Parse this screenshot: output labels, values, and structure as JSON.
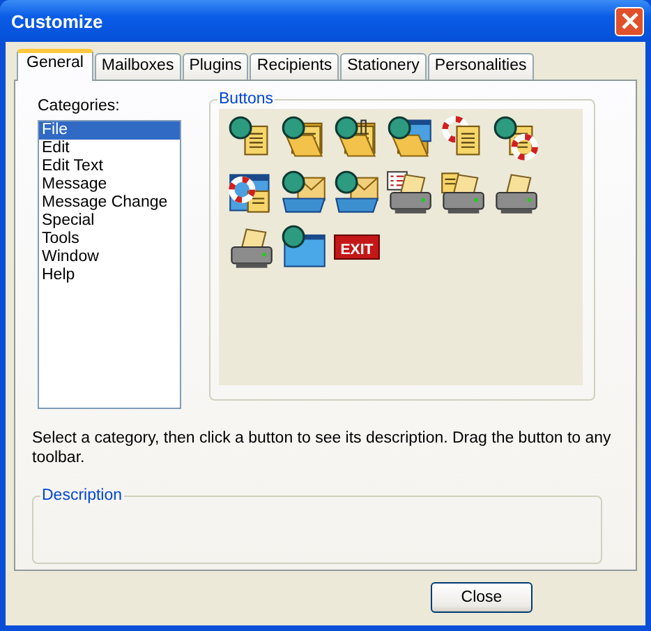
{
  "window": {
    "title": "Customize"
  },
  "tabs": [
    {
      "label": "General",
      "selected": true
    },
    {
      "label": "Mailboxes",
      "selected": false
    },
    {
      "label": "Plugins",
      "selected": false
    },
    {
      "label": "Recipients",
      "selected": false
    },
    {
      "label": "Stationery",
      "selected": false
    },
    {
      "label": "Personalities",
      "selected": false
    }
  ],
  "categories": {
    "label": "Categories:",
    "items": [
      {
        "label": "File",
        "selected": true
      },
      {
        "label": "Edit",
        "selected": false
      },
      {
        "label": "Edit Text",
        "selected": false
      },
      {
        "label": "Message",
        "selected": false
      },
      {
        "label": "Message Change",
        "selected": false
      },
      {
        "label": "Special",
        "selected": false
      },
      {
        "label": "Tools",
        "selected": false
      },
      {
        "label": "Window",
        "selected": false
      },
      {
        "label": "Help",
        "selected": false
      }
    ]
  },
  "buttons_group": {
    "title": "Buttons",
    "buttons": [
      {
        "kind": "globe-doc"
      },
      {
        "kind": "globe-folder"
      },
      {
        "kind": "globe-folder-attach"
      },
      {
        "kind": "globe-folder-window"
      },
      {
        "kind": "lifebuoy-doc"
      },
      {
        "kind": "globe-lifebuoy-doc"
      },
      {
        "kind": "lifebuoy-window"
      },
      {
        "kind": "globe-tray"
      },
      {
        "kind": "down-tray"
      },
      {
        "kind": "list-printer"
      },
      {
        "kind": "doc-printer"
      },
      {
        "kind": "printer"
      },
      {
        "kind": "printer"
      },
      {
        "kind": "globe-window"
      },
      {
        "kind": "exit",
        "label": "EXIT"
      }
    ]
  },
  "hint": "Select a category, then click a button to see its description. Drag the button to any toolbar.",
  "description_group": {
    "title": "Description"
  },
  "buttons": [
    "Close"
  ]
}
